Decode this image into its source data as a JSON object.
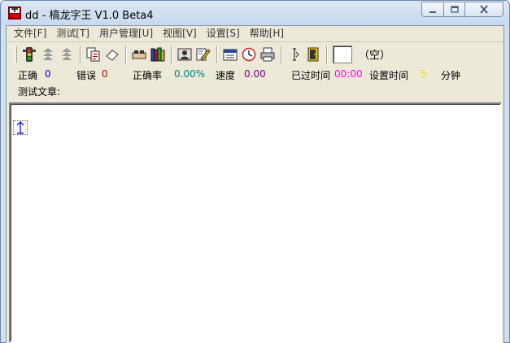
{
  "window": {
    "title": "dd - 槁龙字王 V1.0 Beta4"
  },
  "menu": [
    {
      "label": "文件[F]"
    },
    {
      "label": "测试[T]"
    },
    {
      "label": "用户管理[U]"
    },
    {
      "label": "视图[V]"
    },
    {
      "label": "设置[S]"
    },
    {
      "label": "帮助[H]"
    }
  ],
  "toolbar": {
    "buttons": [
      "traffic-light-icon",
      "stop-arrows-icon",
      "stop-arrows-icon",
      "copy-doc-icon",
      "eraser-icon",
      "handshake-icon",
      "books-icon",
      "user-card-icon",
      "edit-pencil-icon",
      "calendar-icon",
      "clock-icon",
      "printer-icon",
      "cursor-beam-icon",
      "exit-door-icon"
    ],
    "empty_label": "（空）"
  },
  "status": {
    "correct_label": "正确",
    "correct_value": "0",
    "error_label": "错误",
    "error_value": "0",
    "rate_label": "正确率",
    "rate_value": "0.00%",
    "speed_label": "速度",
    "speed_value": "0.00",
    "elapsed_label": "已过时间",
    "elapsed_value": "00:00",
    "set_time_label": "设置时间",
    "set_time_value": "5",
    "minute_label": "分钟"
  },
  "article_label": "测试文章:",
  "colors": {
    "correct": "#0000cc",
    "error": "#cc0000",
    "rate": "#008080",
    "speed": "#800080",
    "elapsed": "#ff00ff",
    "set_time": "#e6e600"
  }
}
